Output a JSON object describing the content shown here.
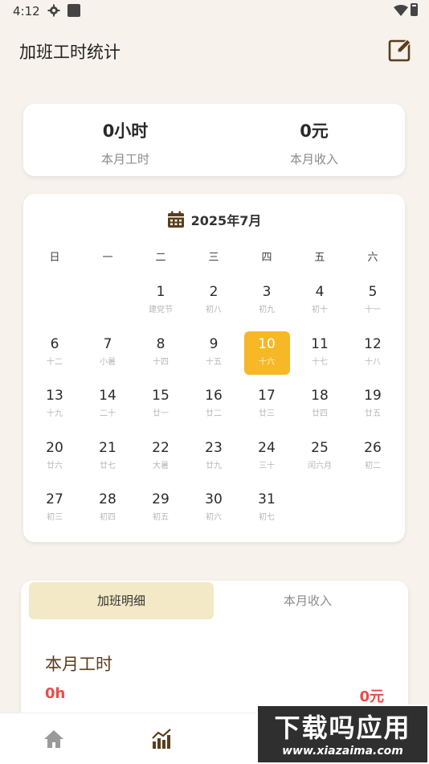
{
  "status_bar": {
    "time": "4:12"
  },
  "header": {
    "title": "加班工时统计"
  },
  "stats": {
    "hours_value": "0小时",
    "hours_label": "本月工时",
    "income_value": "0元",
    "income_label": "本月收入"
  },
  "calendar": {
    "month_title": "2025年7月",
    "weekdays": [
      "日",
      "一",
      "二",
      "三",
      "四",
      "五",
      "六"
    ],
    "leading_blanks": 2,
    "selected_day": "10",
    "days": [
      {
        "n": "1",
        "l": "建党节"
      },
      {
        "n": "2",
        "l": "初八"
      },
      {
        "n": "3",
        "l": "初九"
      },
      {
        "n": "4",
        "l": "初十"
      },
      {
        "n": "5",
        "l": "十一"
      },
      {
        "n": "6",
        "l": "十二"
      },
      {
        "n": "7",
        "l": "小暑"
      },
      {
        "n": "8",
        "l": "十四"
      },
      {
        "n": "9",
        "l": "十五"
      },
      {
        "n": "10",
        "l": "十六"
      },
      {
        "n": "11",
        "l": "十七"
      },
      {
        "n": "12",
        "l": "十八"
      },
      {
        "n": "13",
        "l": "十九"
      },
      {
        "n": "14",
        "l": "二十"
      },
      {
        "n": "15",
        "l": "廿一"
      },
      {
        "n": "16",
        "l": "廿二"
      },
      {
        "n": "17",
        "l": "廿三"
      },
      {
        "n": "18",
        "l": "廿四"
      },
      {
        "n": "19",
        "l": "廿五"
      },
      {
        "n": "20",
        "l": "廿六"
      },
      {
        "n": "21",
        "l": "廿七"
      },
      {
        "n": "22",
        "l": "大暑"
      },
      {
        "n": "23",
        "l": "廿九"
      },
      {
        "n": "24",
        "l": "三十"
      },
      {
        "n": "25",
        "l": "闰六月"
      },
      {
        "n": "26",
        "l": "初二"
      },
      {
        "n": "27",
        "l": "初三"
      },
      {
        "n": "28",
        "l": "初四"
      },
      {
        "n": "29",
        "l": "初五"
      },
      {
        "n": "30",
        "l": "初六"
      },
      {
        "n": "31",
        "l": "初七"
      }
    ]
  },
  "detail": {
    "tabs": [
      "加班明细",
      "本月收入"
    ],
    "title": "本月工时",
    "hours": "0h",
    "income": "0元"
  },
  "watermark": {
    "title": "下载吗应用",
    "url": "www.xiazaima.com"
  },
  "colors": {
    "background": "#f7f2ec",
    "accent": "#f6b826",
    "tab_active": "#f3e9c6",
    "icon_brown": "#5a3e1b",
    "value_red": "#e84c4c"
  }
}
